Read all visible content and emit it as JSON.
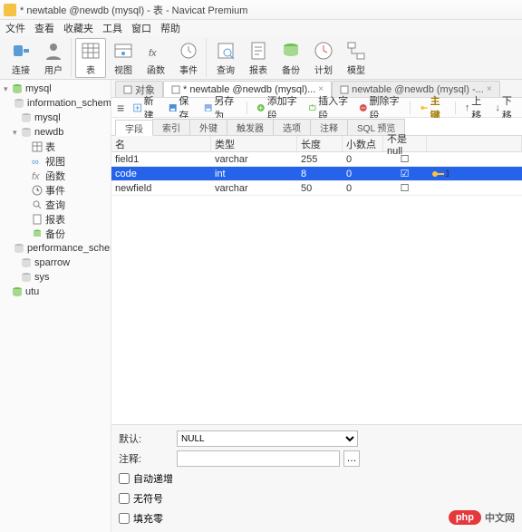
{
  "window": {
    "title": "* newtable @newdb (mysql) - 表 - Navicat Premium"
  },
  "menu": [
    "文件",
    "查看",
    "收藏夹",
    "工具",
    "窗口",
    "帮助"
  ],
  "toolbar": [
    {
      "label": "连接",
      "icon": "plug"
    },
    {
      "label": "用户",
      "icon": "user"
    },
    {
      "label": "表",
      "icon": "table",
      "selected": true
    },
    {
      "label": "视图",
      "icon": "view"
    },
    {
      "label": "函数",
      "icon": "fx"
    },
    {
      "label": "事件",
      "icon": "clock"
    },
    {
      "label": "查询",
      "icon": "query"
    },
    {
      "label": "报表",
      "icon": "report"
    },
    {
      "label": "备份",
      "icon": "backup"
    },
    {
      "label": "计划",
      "icon": "schedule"
    },
    {
      "label": "模型",
      "icon": "model"
    }
  ],
  "tree": [
    {
      "d": 0,
      "arrow": "▾",
      "icon": "db",
      "label": "mysql"
    },
    {
      "d": 1,
      "arrow": "",
      "icon": "schema",
      "label": "information_schema"
    },
    {
      "d": 1,
      "arrow": "",
      "icon": "schema",
      "label": "mysql"
    },
    {
      "d": 1,
      "arrow": "▾",
      "icon": "schema",
      "label": "newdb"
    },
    {
      "d": 2,
      "arrow": "",
      "icon": "tables",
      "label": "表"
    },
    {
      "d": 2,
      "arrow": "",
      "icon": "views",
      "label": "视图"
    },
    {
      "d": 2,
      "arrow": "",
      "icon": "fx",
      "label": "函数"
    },
    {
      "d": 2,
      "arrow": "",
      "icon": "events",
      "label": "事件"
    },
    {
      "d": 2,
      "arrow": "",
      "icon": "queries",
      "label": "查询"
    },
    {
      "d": 2,
      "arrow": "",
      "icon": "reports",
      "label": "报表"
    },
    {
      "d": 2,
      "arrow": "",
      "icon": "backups",
      "label": "备份"
    },
    {
      "d": 1,
      "arrow": "",
      "icon": "schema",
      "label": "performance_schema"
    },
    {
      "d": 1,
      "arrow": "",
      "icon": "schema",
      "label": "sparrow"
    },
    {
      "d": 1,
      "arrow": "",
      "icon": "schema",
      "label": "sys"
    },
    {
      "d": 0,
      "arrow": "",
      "icon": "db",
      "label": "utu"
    }
  ],
  "tabs": [
    {
      "label": "对象",
      "active": false,
      "closable": false
    },
    {
      "label": "* newtable @newdb (mysql)...",
      "active": true,
      "closable": true
    },
    {
      "label": "newtable @newdb (mysql) -...",
      "active": false,
      "closable": true
    }
  ],
  "actions": {
    "menu": "≡",
    "new": "新建",
    "save": "保存",
    "saveas": "另存为",
    "addfield": "添加字段",
    "insertfield": "插入字段",
    "delfield": "删除字段",
    "pk": "主键",
    "up": "上移",
    "down": "下移"
  },
  "subtabs": [
    "字段",
    "索引",
    "外键",
    "触发器",
    "选项",
    "注释",
    "SQL 预览"
  ],
  "activeSubtab": 0,
  "columns": {
    "name": "名",
    "type": "类型",
    "len": "长度",
    "dec": "小数点",
    "null": "不是 null"
  },
  "rows": [
    {
      "name": "field1",
      "type": "varchar",
      "len": "255",
      "dec": "0",
      "null": false,
      "key": false,
      "sel": false
    },
    {
      "name": "code",
      "type": "int",
      "len": "8",
      "dec": "0",
      "null": true,
      "key": true,
      "sel": true
    },
    {
      "name": "newfield",
      "type": "varchar",
      "len": "50",
      "dec": "0",
      "null": false,
      "key": false,
      "sel": false
    }
  ],
  "props": {
    "default_label": "默认:",
    "default_value": "NULL",
    "comment_label": "注释:",
    "comment_value": "",
    "autoinc": "自动递增",
    "unsigned": "无符号",
    "zerofill": "填充零"
  },
  "footerLogo": "中文网",
  "footerBadge": "php"
}
